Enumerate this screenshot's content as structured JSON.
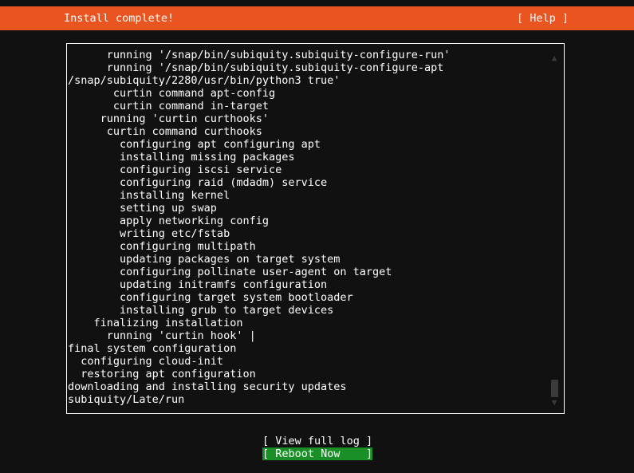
{
  "header": {
    "title": "Install complete!",
    "help_label": "[ Help ]",
    "bg_color": "#e95420",
    "text_color": "#ffffff"
  },
  "log": {
    "lines": [
      "      running '/snap/bin/subiquity.subiquity-configure-run'",
      "      running '/snap/bin/subiquity.subiquity-configure-apt",
      "/snap/subiquity/2280/usr/bin/python3 true'",
      "       curtin command apt-config",
      "       curtin command in-target",
      "     running 'curtin curthooks'",
      "      curtin command curthooks",
      "        configuring apt configuring apt",
      "        installing missing packages",
      "        configuring iscsi service",
      "        configuring raid (mdadm) service",
      "        installing kernel",
      "        setting up swap",
      "        apply networking config",
      "        writing etc/fstab",
      "        configuring multipath",
      "        updating packages on target system",
      "        configuring pollinate user-agent on target",
      "        updating initramfs configuration",
      "        configuring target system bootloader",
      "        installing grub to target devices",
      "    finalizing installation",
      "      running 'curtin hook' |",
      "final system configuration",
      "  configuring cloud-init",
      "  restoring apt configuration",
      "downloading and installing security updates",
      "subiquity/Late/run"
    ],
    "scrollbar": {
      "up_arrow": "▲",
      "down_arrow": "▼",
      "thumb_color": "#3a3a3a"
    }
  },
  "footer": {
    "view_full_log_label": "[ View full log ]",
    "reboot_now_label": "[ Reboot Now    ]",
    "reboot_highlight_color": "#1a8f27"
  }
}
